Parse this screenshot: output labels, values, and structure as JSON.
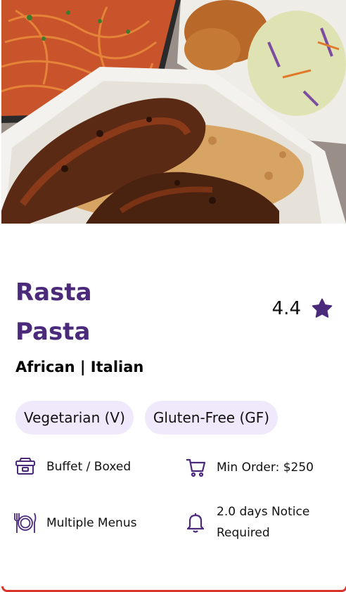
{
  "item": {
    "title_line1": "Rasta",
    "title_line2": "Pasta",
    "rating": "4.4",
    "cuisine": "African | Italian"
  },
  "tags": [
    "Vegetarian (V)",
    "Gluten-Free (GF)"
  ],
  "features": {
    "service": {
      "label": "Buffet / Boxed",
      "icon": "food-box-icon"
    },
    "min_order": {
      "label": "Min Order: $250",
      "icon": "cart-icon"
    },
    "menus": {
      "label": "Multiple Menus",
      "icon": "plate-cutlery-icon"
    },
    "notice_line1": "2.0 days Notice",
    "notice_line2": "Required",
    "notice_icon": "bell-icon"
  },
  "colors": {
    "accent": "#4b2a7b",
    "tag_bg": "#f0e9fb",
    "card_edge": "#d9362b"
  }
}
